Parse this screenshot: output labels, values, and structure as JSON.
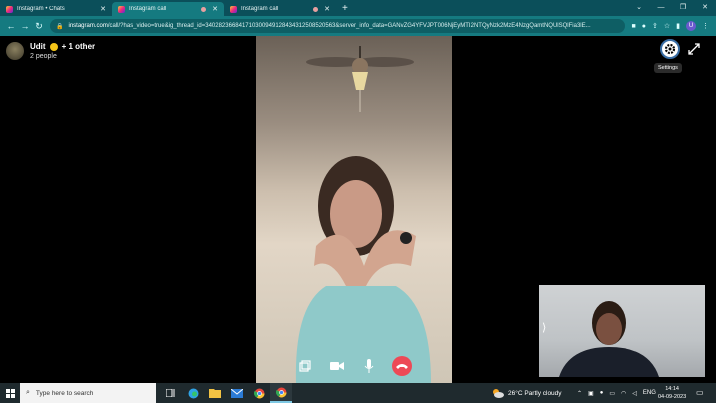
{
  "browser": {
    "tabs": [
      {
        "title": "Instagram • Chats",
        "active": false,
        "recording": false
      },
      {
        "title": "Instagram call",
        "active": true,
        "recording": true
      },
      {
        "title": "Instagram call",
        "active": false,
        "recording": true
      }
    ],
    "url_host": "instagram.com",
    "url_path": "/call/?has_video=true&ig_thread_id=340282366841710300949128434312508520563&server_info_data=GANvZG4YFVJPT006NjEyMTI2NTQyNzk2MzE4NzgQamtNQUlSQlFia3lE...",
    "profile_initial": "U"
  },
  "call": {
    "name": "Udit",
    "others": "+ 1 other",
    "subtitle": "2 people",
    "settings_tooltip": "Settings"
  },
  "taskbar": {
    "search_placeholder": "Type here to search",
    "weather": "26°C  Partly cloudy",
    "lang": "ENG",
    "time": "14:14",
    "date": "04-09-2023"
  },
  "colors": {
    "tabbar": "#0b4f5a",
    "addressbar": "#157a80",
    "end_call": "#ed4956"
  }
}
